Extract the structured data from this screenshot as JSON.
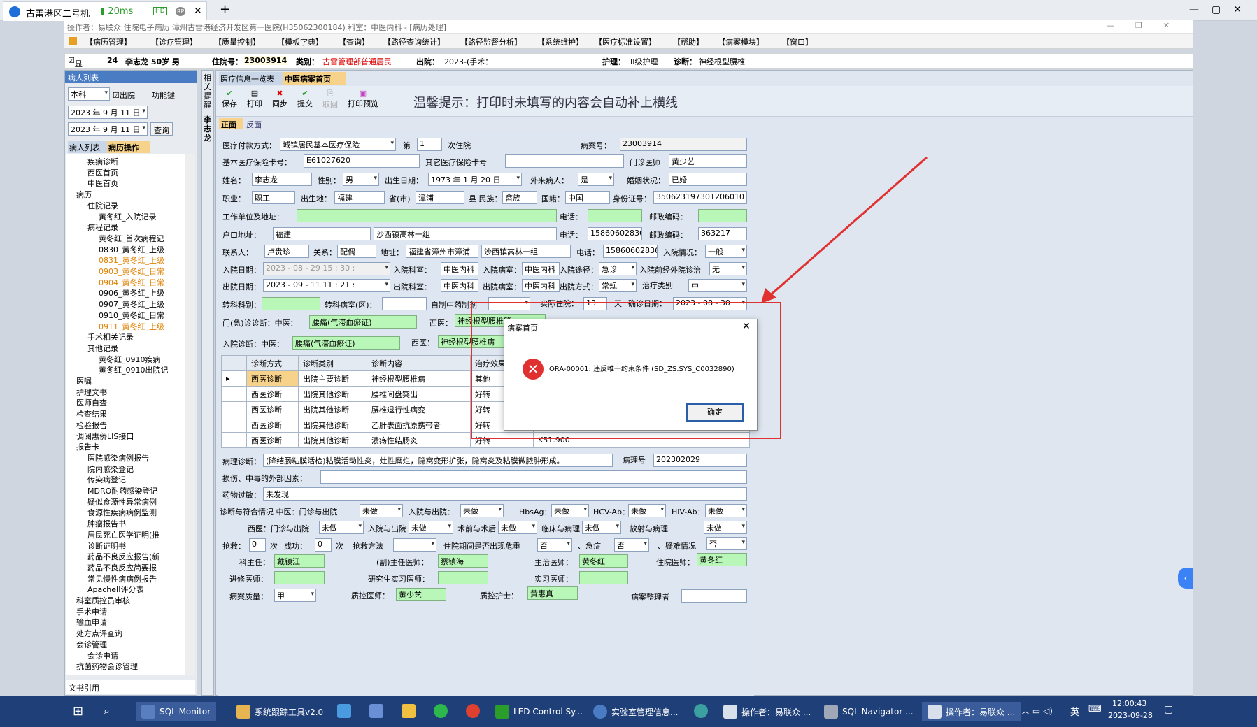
{
  "browser": {
    "tab_title": "古雷港区二号机",
    "ping": "20ms",
    "hd": "HD",
    "rp": "RP",
    "close": "✕",
    "new_tab": "+"
  },
  "window": {
    "title": "操作者：易联众 住院电子病历 漳州古雷港经济开发区第一医院(H35062300184) 科室：中医内科 - [病历处理]"
  },
  "menu": [
    "【病历管理】",
    "【诊疗管理】",
    "【质量控制】",
    "【模板字典】",
    "【查询】",
    "【路径查询统计】",
    "【路径监督分析】",
    "【系统维护】",
    "【医疗标准设置】",
    "【帮助】",
    "【病案模块】",
    "【窗口】"
  ],
  "patient_bar": {
    "show": "显示",
    "bed": "24",
    "name_age": "李志龙 50岁 男",
    "inpatient_label": "住院号：",
    "inpatient_no": "23003914",
    "category_label": "类别：",
    "category": "古雷管理部普通居民",
    "discharge_label": "出院：",
    "discharge": "2023-(手术：",
    "nursing_label": "护理：",
    "nursing": "II级护理",
    "diagnosis_label": "诊断：",
    "diagnosis": "神经根型腰椎"
  },
  "left_panel": {
    "title": "病人列表",
    "dept": "本科",
    "discharged": "出院",
    "func_key": "功能键",
    "date_from": "2023 年 9 月 11 日",
    "date_to": "2023 年 9 月 11 日",
    "query": "查询",
    "tab1": "病人列表",
    "tab2": "病历操作",
    "footer": "文书引用",
    "tree": [
      "疾病诊断",
      "西医首页",
      "中医首页",
      "病历",
      "住院记录",
      "黄冬红_入院记录",
      "病程记录",
      "黄冬红_首次病程记",
      "0830_黄冬红_上级",
      "0831_黄冬红_上级",
      "0903_黄冬红_日常",
      "0904_黄冬红_日常",
      "0906_黄冬红_上级",
      "0907_黄冬红_上级",
      "0910_黄冬红_日常",
      "0911_黄冬红_上级",
      "手术相关记录",
      "其他记录",
      "黄冬红_0910疾病",
      "黄冬红_0910出院记",
      "医嘱",
      "护理文书",
      "医师自查",
      "检查结果",
      "检验报告",
      "调阅惠侨LIS接口",
      "报告卡",
      "医院感染病例报告",
      "院内感染登记",
      "传染病登记",
      "MDRO耐药感染登记",
      "疑似食源性异常病例",
      "食源性疾病病例监测",
      "肿瘤报告书",
      "居民死亡医学证明(推",
      "诊断证明书",
      "药品不良反应报告(新",
      "药品不良反应简要报",
      "常见慢性病病例报告",
      "ApacheII评分表",
      "科室质控员审核",
      "手术申请",
      "输血申请",
      "处方点评查询",
      "会诊管理",
      "会诊申请",
      "抗菌药物会诊管理"
    ]
  },
  "side_tab": "相关提醒",
  "side_name": "李志龙",
  "main_tabs": [
    "医疗信息一览表",
    "中医病案首页"
  ],
  "toolbar": [
    "保存",
    "打印",
    "同步",
    "提交",
    "取回",
    "打印预览"
  ],
  "tip": "温馨提示：打印时未填写的内容会自动补上横线",
  "sub_tabs": [
    "正面",
    "反面"
  ],
  "form": {
    "pay_label": "医疗付款方式：",
    "pay": "城镇居民基本医疗保险",
    "di": "第",
    "times": "1",
    "times_suffix": "次住院",
    "case_no_label": "病案号：",
    "case_no": "23003914",
    "card_label": "基本医疗保险卡号：",
    "card": "E61027620",
    "other_card_label": "其它医疗保险卡号",
    "doctor_label": "门诊医师",
    "doctor": "黄少艺",
    "name_label": "姓名：",
    "name": "李志龙",
    "sex_label": "性别：",
    "sex": "男",
    "birth_label": "出生日期：",
    "birth": "1973 年 1 月 20 日",
    "outsider_label": "外来病人：",
    "outsider": "是",
    "marry_label": "婚姻状况：",
    "marry": "已婚",
    "job_label": "职业：",
    "job": "职工",
    "birthplace_label": "出生地：",
    "birthplace": "福建",
    "prov_label": "省(市)",
    "city": "漳浦",
    "county_label": "县 民族：",
    "nation": "畲族",
    "country_label": "国籍：",
    "country": "中国",
    "id_label": "身份证号：",
    "id": "350623197301206010",
    "work_label": "工作单位及地址：",
    "tel_label": "电话：",
    "post_label": "邮政编码：",
    "hukou_label": "户口地址：",
    "hukou1": "福建",
    "hukou2": "沙西镇高林一组",
    "tel2": "15860602836",
    "post2": "363217",
    "contact_label": "联系人：",
    "contact": "卢贵珍",
    "rel_label": "关系：",
    "rel": "配偶",
    "addr_label": "地址：",
    "addr1": "福建省漳州市漳浦",
    "addr2": "沙西镇高林一组",
    "tel3": "15860602836",
    "admit_cond_label": "入院情况：",
    "admit_cond": "一般",
    "admit_date_label": "入院日期：",
    "admit_date": "2023 - 08 - 29   15 : 30 :",
    "admit_dept_label": "入院科室：",
    "admit_dept": "中医内科",
    "admit_ward_label": "入院病室：",
    "admit_ward": "中医内科",
    "admit_way_label": "入院途径：",
    "admit_way": "急诊",
    "pre_label": "入院前经外院诊治",
    "pre": "无",
    "dis_date_label": "出院日期：",
    "dis_date": "2023 - 09 - 11   11 : 21 :",
    "dis_dept_label": "出院科室：",
    "dis_dept": "中医内科",
    "dis_ward_label": "出院病室：",
    "dis_ward": "中医内科",
    "dis_way_label": "出院方式：",
    "dis_way": "常规",
    "treat_label": "治疗类别",
    "treat": "中",
    "transfer_label": "转科科别：",
    "transfer_ward_label": "转科病室(区)：",
    "herb_label": "自制中药制剂",
    "days_label": "实际住院：",
    "days": "13",
    "days_unit": "天",
    "confirm_label": "确诊日期：",
    "confirm": "2023 - 08 - 30",
    "op_diag_label": "门(急)诊诊断：中医：",
    "op_diag_cn": "腰痛(气滞血瘀证)",
    "op_diag_w_label": "西医：",
    "op_diag_w": "神经根型腰椎管",
    "in_diag_label": "入院诊断：中医：",
    "in_diag_cn": "腰痛(气滞血瘀证)",
    "in_diag_w_label": "西医：",
    "in_diag_w": "神经根型腰椎病",
    "grid_headers": [
      "诊断方式",
      "诊断类别",
      "诊断内容",
      "治疗效果"
    ],
    "grid_rows": [
      [
        "西医诊断",
        "出院主要诊断",
        "神经根型腰椎病",
        "其他"
      ],
      [
        "西医诊断",
        "出院其他诊断",
        "腰椎间盘突出",
        "好转"
      ],
      [
        "西医诊断",
        "出院其他诊断",
        "腰椎退行性病变",
        "好转"
      ],
      [
        "西医诊断",
        "出院其他诊断",
        "乙肝表面抗原携带者",
        "好转"
      ],
      [
        "西医诊断",
        "出院其他诊断",
        "溃疡性结肠炎",
        "好转"
      ]
    ],
    "grid_extra": "K51.900",
    "patho_label": "病理诊断：",
    "patho": "(降结肠粘膜活检)粘膜活动性炎，灶性糜烂，隐窝变形扩张，隐窝炎及粘膜微脓肿形成。",
    "patho_no_label": "病理号",
    "patho_no": "202302029",
    "injury_label": "损伤、中毒的外部因素：",
    "allergy_label": "药物过敏：",
    "allergy": "未发现",
    "match_label": "诊断与符合情况  中医：门诊与出院",
    "undone": "未做",
    "in_out_label": "入院与出院：",
    "hbsag": "HbsAg：",
    "hcv": "HCV-Ab：",
    "hiv": "HIV-Ab：",
    "west_label": "西医：门诊与出院",
    "west_in_out": "入院与出院",
    "pre_post": "术前与术后",
    "clin_patho": "临床与病理",
    "radio_patho": "放射与病理",
    "rescue_label": "抢救：",
    "rescue": "0",
    "rescue_unit": "次",
    "success_label": "成功：",
    "success": "0",
    "success_unit": "次",
    "rescue_method": "抢救方法",
    "danger_label": "住院期间是否出现危重",
    "no": "否",
    "emerg_label": "、急症",
    "difficult_label": "、疑难情况",
    "director_label": "科主任：",
    "director": "戴镇江",
    "vice_label": "(副)主任医师：",
    "vice": "蔡镇海",
    "attending_label": "主治医师：",
    "attending": "黄冬红",
    "resident_label": "住院医师：",
    "resident": "黄冬红",
    "advanced_label": "进修医师：",
    "grad_label": "研究生实习医师：",
    "intern_label": "实习医师：",
    "quality_label": "病案质量：",
    "quality": "甲",
    "qc_doc_label": "质控医师：",
    "qc_doc": "黄少艺",
    "qc_nurse_label": "质控护士：",
    "qc_nurse": "黄惠真",
    "sorter_label": "病案整理者"
  },
  "dialog": {
    "title": "病案首页",
    "close": "✕",
    "message": "ORA-00001: 违反唯一约束条件 (SD_ZS.SYS_C0032890)",
    "ok": "确定"
  },
  "taskbar": {
    "items": [
      "SQL Monitor",
      "系统跟踪工具v2.0",
      "LED Control Sy...",
      "实验室管理信息...",
      "操作者：易联众 ...",
      "SQL Navigator ...",
      "操作者：易联众 ..."
    ],
    "lang": "英",
    "time": "12:00:43",
    "date": "2023-09-28"
  },
  "colors": {
    "accent_red": "#e03030",
    "green_field": "#b9f7b9",
    "taskbar": "#1f3f78"
  }
}
